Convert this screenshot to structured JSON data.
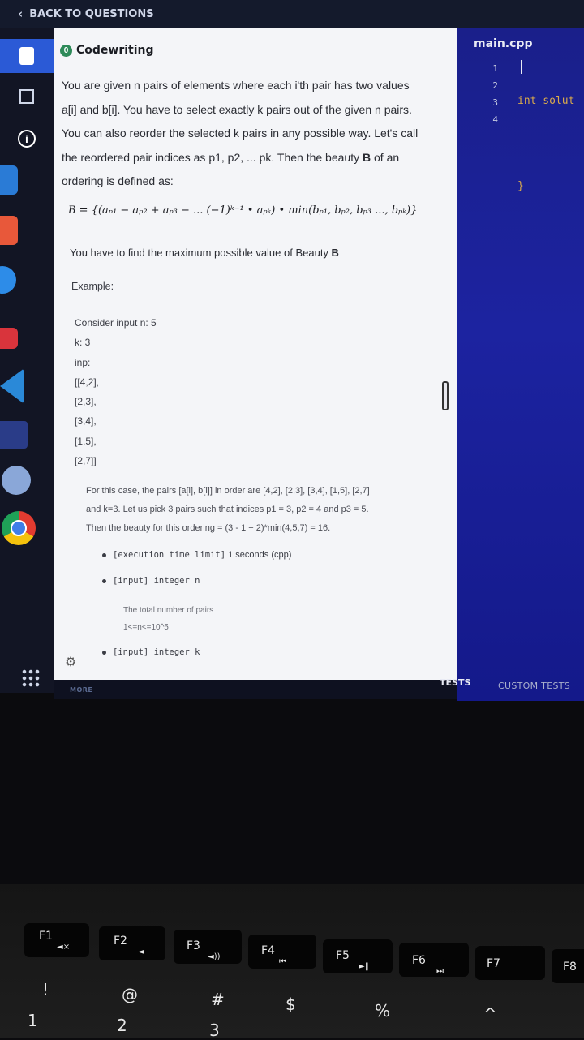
{
  "nav": {
    "back_label": "BACK TO QUESTIONS"
  },
  "task": {
    "type_badge": "0",
    "type_label": "Codewriting",
    "description": [
      {
        "pre": "You are given n pairs of elements where each i'th pair has two values"
      },
      {
        "pre": "a[i] and b[i]. You have to select exactly k pairs out of the given n pairs."
      },
      {
        "pre": "You can also reorder the selected k pairs in any possible way. Let's call"
      },
      {
        "pre": "the reordered pair indices as p1, p2, ... pk. Then the beauty ",
        "bold": "B",
        "post": " of an"
      },
      {
        "pre": "ordering is defined as:"
      }
    ],
    "formula": "B = {(aₚ₁ − aₚ₂ + aₚ₃ − ... (−1)ᵏ⁻¹ • aₚₖ) • min(bₚ₁, bₚ₂, bₚ₃ ..., bₚₖ)}",
    "find_text": "You have to find the maximum possible value of Beauty ",
    "find_bold": "B",
    "example_label": "Example:",
    "example_lines": [
      "Consider input n: 5",
      "k: 3",
      "inp:",
      "[[4,2],",
      "[2,3],",
      "[3,4],",
      "[1,5],",
      "[2,7]]"
    ],
    "case_lines": [
      "For this case, the pairs [a[i], b[i]] in order are [4,2], [2,3], [3,4], [1,5], [2,7]",
      "and k=3. Let us pick 3 pairs such that indices p1 = 3, p2 = 4 and p3 = 5.",
      "Then the beauty for this ordering = (3 - 1 + 2)*min(4,5,7) = 16."
    ],
    "bullets": [
      {
        "tag": "[execution time limit]",
        "text": " 1 seconds (cpp)"
      },
      {
        "tag": "[input] integer n",
        "text": ""
      },
      {
        "tag": "[input] integer k",
        "text": ""
      }
    ],
    "n_note": "The total number of pairs",
    "n_constraint": "1<=n<=10^5",
    "more_label": "MORE"
  },
  "editor": {
    "file_name": "main.cpp",
    "line_numbers": [
      "1",
      "2",
      "3",
      "4"
    ],
    "code_lines": [
      "int solut",
      "",
      "}",
      ""
    ],
    "tabs": {
      "tests": "TESTS",
      "custom_tests": "CUSTOM TESTS"
    }
  },
  "keyboard": {
    "fkeys": [
      {
        "label": "F1",
        "icon": "◄×"
      },
      {
        "label": "F2",
        "icon": "◄"
      },
      {
        "label": "F3",
        "icon": "◄))"
      },
      {
        "label": "F4",
        "icon": "⏮"
      },
      {
        "label": "F5",
        "icon": "►‖"
      },
      {
        "label": "F6",
        "icon": "⏭"
      },
      {
        "label": "F7",
        "icon": ""
      },
      {
        "label": "F8",
        "icon": ""
      }
    ],
    "symbols": [
      "!",
      "@",
      "#",
      "$",
      "%",
      "^",
      "1",
      "2",
      "3"
    ]
  },
  "colors": {
    "panel_bg": "#f4f5f8",
    "editor_bg": "#1c23a0",
    "badge_green": "#2d8a59",
    "accent_blue": "#2b5ad6"
  }
}
